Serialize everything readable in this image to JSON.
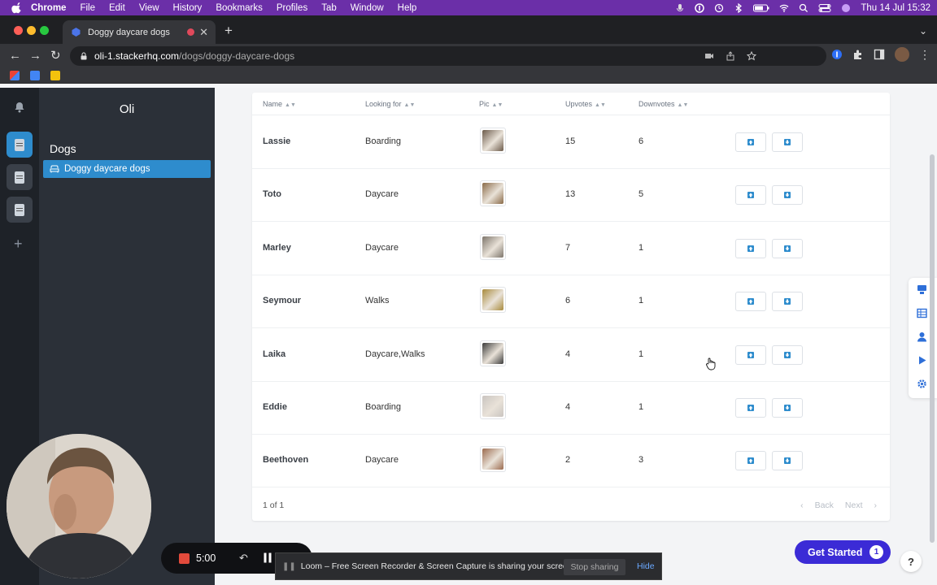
{
  "menubar": {
    "app": "Chrome",
    "items": [
      "File",
      "Edit",
      "View",
      "History",
      "Bookmarks",
      "Profiles",
      "Tab",
      "Window",
      "Help"
    ],
    "clock": "Thu 14 Jul  15:32"
  },
  "browser": {
    "tab_title": "Doggy daycare dogs",
    "url_host": "oli-1.stackerhq.com",
    "url_path": "/dogs/doggy-daycare-dogs"
  },
  "sidebar": {
    "app_name": "Oli",
    "section": "Dogs",
    "active_item": "Doggy daycare dogs"
  },
  "table": {
    "columns": [
      "Name",
      "Looking for",
      "Pic",
      "Upvotes",
      "Downvotes"
    ],
    "rows": [
      {
        "name": "Lassie",
        "looking_for": "Boarding",
        "upvotes": "15",
        "downvotes": "6",
        "pic_color": "#6b5a4a"
      },
      {
        "name": "Toto",
        "looking_for": "Daycare",
        "upvotes": "13",
        "downvotes": "5",
        "pic_color": "#8a6a48"
      },
      {
        "name": "Marley",
        "looking_for": "Daycare",
        "upvotes": "7",
        "downvotes": "1",
        "pic_color": "#7d756b"
      },
      {
        "name": "Seymour",
        "looking_for": "Walks",
        "upvotes": "6",
        "downvotes": "1",
        "pic_color": "#a88a3c"
      },
      {
        "name": "Laika",
        "looking_for": "Daycare,Walks",
        "upvotes": "4",
        "downvotes": "1",
        "pic_color": "#3b3b3b"
      },
      {
        "name": "Eddie",
        "looking_for": "Boarding",
        "upvotes": "4",
        "downvotes": "1",
        "pic_color": "#c9c4c0"
      },
      {
        "name": "Beethoven",
        "looking_for": "Daycare",
        "upvotes": "2",
        "downvotes": "3",
        "pic_color": "#9b6a4e"
      }
    ],
    "page_count": "1 of 1",
    "back_label": "Back",
    "next_label": "Next"
  },
  "cta": {
    "get_started": "Get Started",
    "badge": "1",
    "help": "?"
  },
  "loom": {
    "timer": "5:00",
    "message": "Loom – Free Screen Recorder & Screen Capture is sharing your screen.",
    "stop_sharing": "Stop sharing",
    "hide": "Hide"
  },
  "colors": {
    "menubar": "#6b2fa8",
    "sidebar_active": "#2e8ccd",
    "cta": "#3b2bd6",
    "rail_active": "#2e8ccd",
    "vote_icon": "#2e8ccd"
  }
}
